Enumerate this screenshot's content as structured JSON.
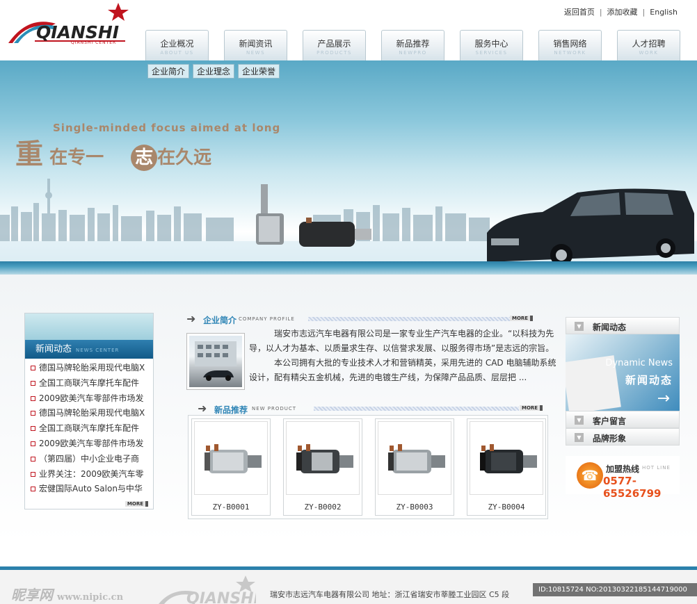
{
  "header": {
    "logo_text": "QIANSHI",
    "logo_tagline": "QIANSHI CENTER",
    "top_links": [
      "返回首页",
      "添加收藏",
      "English"
    ]
  },
  "nav": [
    {
      "cn": "企业概况",
      "en": "ABOUT US"
    },
    {
      "cn": "新闻资讯",
      "en": "NEWS"
    },
    {
      "cn": "产品展示",
      "en": "PRODUCTS"
    },
    {
      "cn": "新品推荐",
      "en": "NEWPRO"
    },
    {
      "cn": "服务中心",
      "en": "SERVICES"
    },
    {
      "cn": "销售网络",
      "en": "NETWORK"
    },
    {
      "cn": "人才招聘",
      "en": "WORK"
    }
  ],
  "subnav": [
    "企业简介",
    "企业理念",
    "企业荣誉"
  ],
  "banner": {
    "slogan_en": "Single-minded focus aimed at long",
    "slogan_big1": "重",
    "slogan_cn1": "在专一",
    "slogan_big2": "志",
    "slogan_cn2": "在久远"
  },
  "left": {
    "title": "新闻动态",
    "title_en": "NEWS CENTER",
    "news": [
      "德国马牌轮胎采用现代电脑X",
      "全国工商联汽车摩托车配件",
      "2009欧美汽车零部件市场发",
      "德国马牌轮胎采用现代电脑X",
      "全国工商联汽车摩托车配件",
      "2009欧美汽车零部件市场发",
      "（第四届）中小企业电子商",
      "业界关注：2009欧美汽车零",
      "宏健国际Auto Salon与中华"
    ],
    "more": "MORE"
  },
  "about": {
    "title": "企业简介",
    "title_en": "COMPANY PROFILE",
    "more": "MORE",
    "para1": "瑞安市志远汽车电器有限公司是一家专业生产汽车电器的企业。“以科技为先导，以人才为基本、以质量求生存、以信誉求发展、以服务得市场”是志远的宗旨。",
    "para2": "本公司拥有大批的专业技术人才和营销精英，采用先进的 CAD 电脑辅助系统设计，配有精尖五金机械，先进的电镀生产线，为保障产品品质、层层把 ..."
  },
  "newpro": {
    "title": "新品推荐",
    "title_en": "NEW PRODUCT",
    "more": "MORE",
    "items": [
      "ZY-B0001",
      "ZY-B0002",
      "ZY-B0003",
      "ZY-B0004"
    ]
  },
  "right": {
    "tab1": "新闻动态",
    "feature_en": "Dynamic News",
    "feature_cn": "新闻动态",
    "tab2": "客户留言",
    "tab3": "品牌形象",
    "hotline_label": "加盟热线",
    "hotline_en": "HOT LINE",
    "hotline_number": "0577-65526799"
  },
  "footer": {
    "text": "瑞安市志远汽车电器有限公司  地址：浙江省瑞安市莘塍工业园区 C5 段",
    "watermark": "昵享网",
    "watermark_url": "www.nipic.cn",
    "id_text": "ID:10815724 NO:20130322185144719000"
  },
  "colors": {
    "brand_red": "#c0141e",
    "accent_blue": "#2d84b5",
    "footer_blue": "#2b80ab",
    "hotline_orange": "#e7511d"
  }
}
